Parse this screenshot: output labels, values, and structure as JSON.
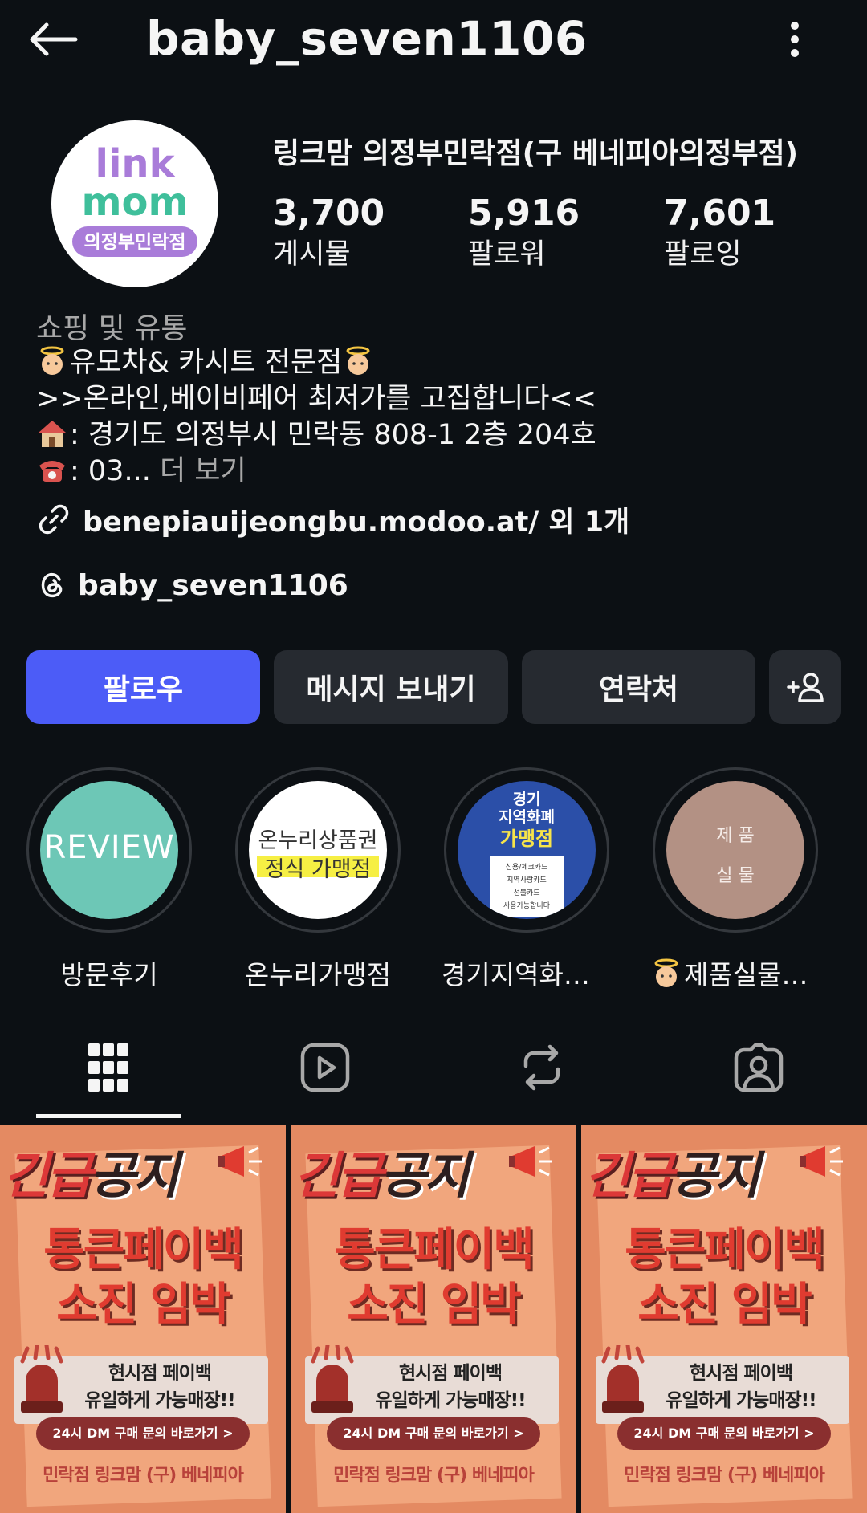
{
  "header": {
    "username": "baby_seven1106"
  },
  "profile": {
    "display_name": "링크맘 의정부민락점(구 베네피아의정부점)",
    "avatar": {
      "line1": "link",
      "line2": "mom",
      "badge": "의정부민락점"
    },
    "stats": [
      {
        "value": "3,700",
        "label": "게시물"
      },
      {
        "value": "5,916",
        "label": "팔로워"
      },
      {
        "value": "7,601",
        "label": "팔로잉"
      }
    ],
    "category": "쇼핑 및 유통",
    "bio": {
      "line1": "유모차& 카시트 전문점",
      "line2": ">>온라인,베이비페어 최저가를 고집합니다<<",
      "line3": ": 경기도 의정부시 민락동 808-1 2층 204호",
      "line4": ": 03...",
      "more": " 더 보기"
    },
    "link": "benepiauijeongbu.modoo.at/ 외 1개",
    "threads": "baby_seven1106"
  },
  "buttons": {
    "follow": "팔로우",
    "message": "메시지 보내기",
    "contact": "연락처"
  },
  "highlights": [
    {
      "label": "방문후기",
      "cover_text": "REVIEW"
    },
    {
      "label": "온누리가맹점",
      "cover_line1": "온누리상품권",
      "cover_line2": "정식 가맹점"
    },
    {
      "label": "경기지역화폐 가...",
      "cover_line1": "경기",
      "cover_line2": "지역화폐",
      "cover_line3": "가맹점",
      "cover_small1": "신용/체크카드",
      "cover_small2": "지역사랑카드",
      "cover_small3": "선불카드",
      "cover_small4": "사용가능합니다"
    },
    {
      "label": "제품실물사진...",
      "cover_line1": "제 품",
      "cover_line2": "실 물"
    }
  ],
  "posts": [
    {
      "title_a": "긴급",
      "title_b": "공지",
      "head1": "통큰페이백",
      "head2": "소진  임박",
      "box1": "현시점 페이백",
      "box2": "유일하게 가능매장!!",
      "pill": "24시 DM 구매 문의 바로가기  >",
      "footer": "민락점 링크맘 (구) 베네피아"
    },
    {
      "title_a": "긴급",
      "title_b": "공지",
      "head1": "통큰페이백",
      "head2": "소진  임박",
      "box1": "현시점 페이백",
      "box2": "유일하게 가능매장!!",
      "pill": "24시 DM 구매 문의 바로가기  >",
      "footer": "민락점 링크맘 (구) 베네피아"
    },
    {
      "title_a": "긴급",
      "title_b": "공지",
      "head1": "통큰페이백",
      "head2": "소진  임박",
      "box1": "현시점 페이백",
      "box2": "유일하게 가능매장!!",
      "pill": "24시 DM 구매 문의 바로가기  >",
      "footer": "민락점 링크맘 (구) 베네피아"
    }
  ],
  "colors": {
    "background": "#0c1014",
    "follow_button": "#4c5cf7",
    "secondary_button": "#262a30",
    "muted_text": "#a8a8a8",
    "brand_purple": "#a97cd9",
    "brand_green": "#3fbf9b"
  },
  "icons": {
    "back": "arrow-left-icon",
    "more": "vertical-dots-icon",
    "link": "link-icon",
    "threads": "threads-icon",
    "add_user": "add-person-icon",
    "tabs": [
      "grid-icon",
      "reels-icon",
      "reposts-icon",
      "tagged-icon"
    ]
  }
}
